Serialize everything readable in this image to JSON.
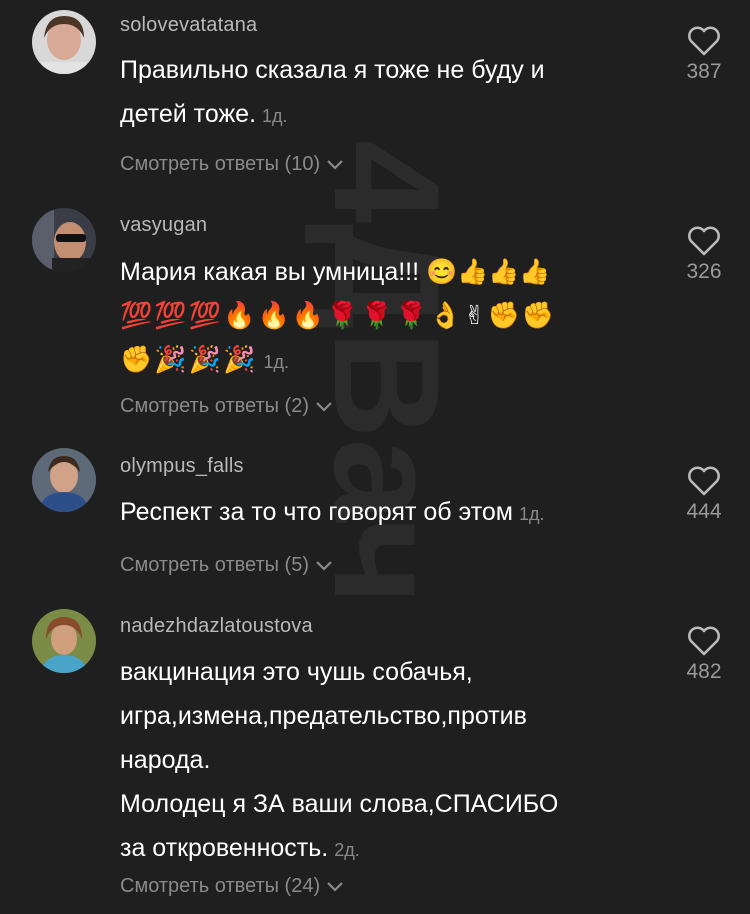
{
  "watermark_text": "4ДВач",
  "comments": [
    {
      "username": "solovevatatana",
      "text_lines": [
        "Правильно сказала я тоже не буду и",
        "детей тоже."
      ],
      "time": "1д.",
      "replies": "Смотреть ответы (10)",
      "likes": "387",
      "avatar_colors": [
        "#cfa89a",
        "#5a4636"
      ]
    },
    {
      "username": "vasyugan",
      "text_lines": [
        "Мария какая вы умница!!! 😊👍👍👍",
        "💯💯💯🔥🔥🔥🌹🌹🌹👌✌✊✊",
        "✊🎉🎉🎉"
      ],
      "time": "1д.",
      "replies": "Смотреть ответы (2)",
      "likes": "326",
      "avatar_colors": [
        "#6b7080",
        "#222"
      ]
    },
    {
      "username": "olympus_falls",
      "text_lines": [
        "Респект за то что говорят об этом"
      ],
      "time": "1д.",
      "replies": "Смотреть ответы (5)",
      "likes": "444",
      "avatar_colors": [
        "#3b5a8a",
        "#c49a82"
      ]
    },
    {
      "username": "nadezhdazlatoustova",
      "text_lines": [
        "вакцинация это чушь собачья,",
        "игра,измена,предательство,против",
        "народа.",
        "Молодец я ЗА ваши слова,СПАСИБО",
        "за откровенность."
      ],
      "time": "2д.",
      "replies": "Смотреть ответы (24)",
      "likes": "482",
      "avatar_colors": [
        "#6f8c3a",
        "#caa06a"
      ]
    }
  ]
}
